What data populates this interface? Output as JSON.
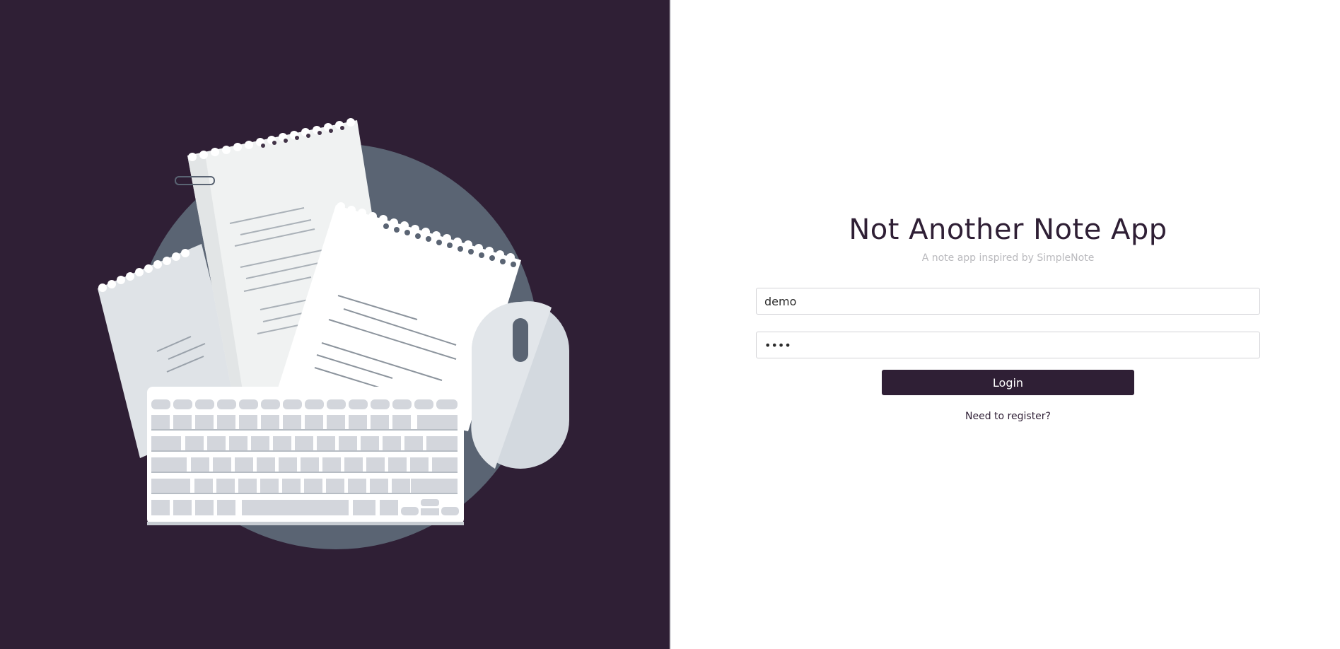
{
  "app": {
    "title": "Not Another Note App",
    "subtitle": "A note app inspired by SimpleNote"
  },
  "login_form": {
    "username_value": "demo",
    "password_value": "demo",
    "login_label": "Login",
    "register_label": "Need to register?"
  },
  "illustration": {
    "name": "notes-keyboard-mouse-illustration"
  },
  "colors": {
    "brand": "#2f1f35",
    "circle": "#5a6473",
    "paper": "#f1f2f2",
    "key": "#d3d6dc"
  }
}
